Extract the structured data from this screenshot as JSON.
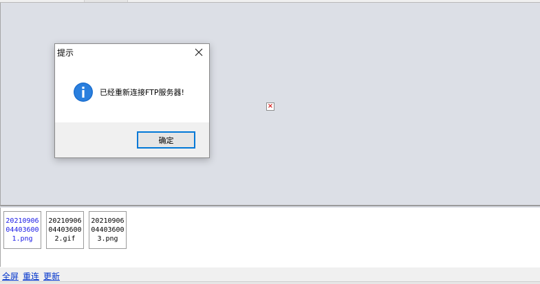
{
  "dialog": {
    "title": "提示",
    "message": "已经重新连接FTP服务器!",
    "ok_label": "确定",
    "icon": "info-icon",
    "close_icon": "close-icon"
  },
  "preview": {
    "broken_image_icon": "broken-image-icon",
    "broken_image_glyph": "×"
  },
  "thumbnails": [
    {
      "lines": [
        "20210906",
        "04403600",
        "1.png"
      ],
      "selected": true
    },
    {
      "lines": [
        "20210906",
        "04403600",
        "2.gif"
      ],
      "selected": false
    },
    {
      "lines": [
        "20210906",
        "04403600",
        "3.png"
      ],
      "selected": false
    }
  ],
  "bottom_links": {
    "fullscreen": "全屏",
    "reconnect": "重连",
    "refresh": "更新"
  },
  "colors": {
    "accent": "#0078d7",
    "link": "#0033cc",
    "selected_thumb_text": "#1a1ae6",
    "preview_bg": "#dcdfe6"
  }
}
